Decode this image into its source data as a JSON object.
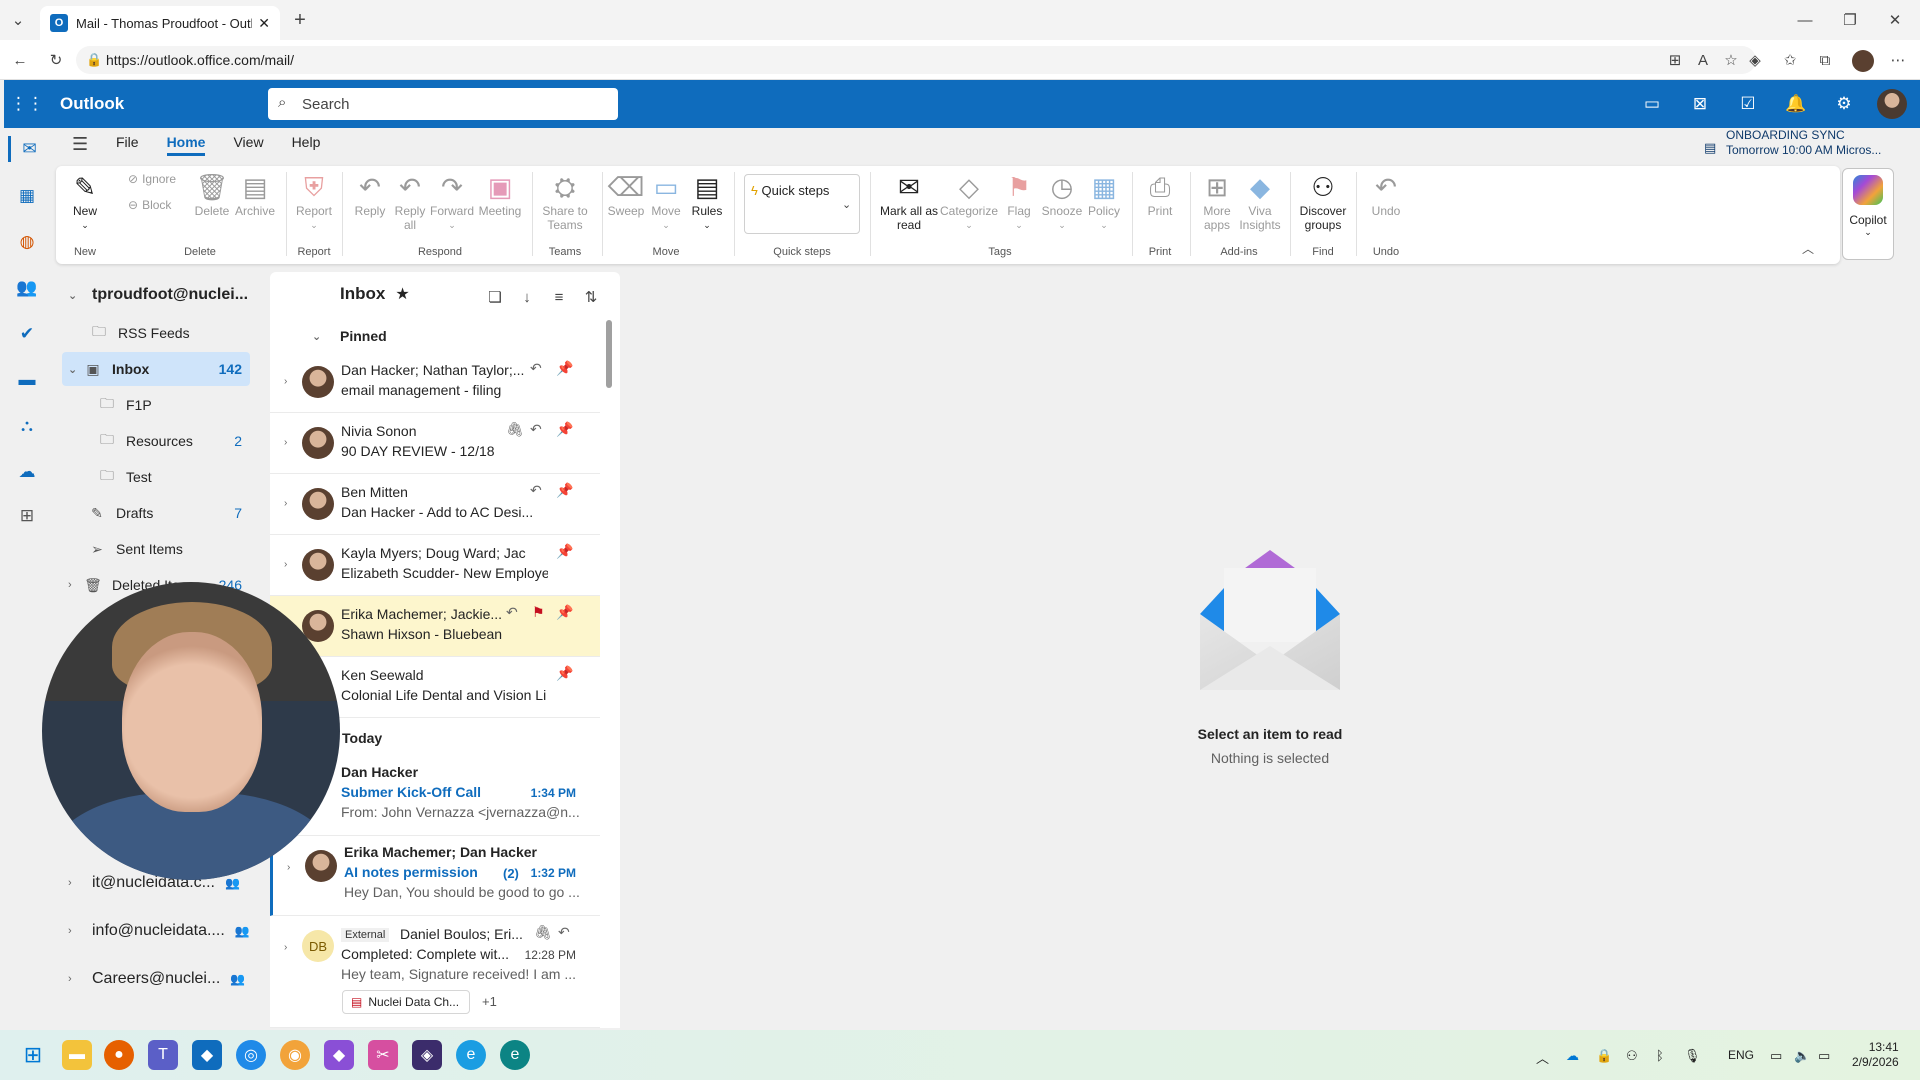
{
  "browser": {
    "tab_title": "Mail - Thomas Proudfoot - Outlook",
    "url": "https://outlook.office.com/mail/"
  },
  "app": {
    "name": "Outlook",
    "search_placeholder": "Search",
    "accent": "#0f6cbd"
  },
  "menu": [
    "File",
    "Home",
    "View",
    "Help"
  ],
  "onboarding": {
    "title": "ONBOARDING SYNC",
    "time": "Tomorrow 10:00 AM Micros..."
  },
  "ribbon": {
    "new": "New",
    "ignore": "Ignore",
    "block": "Block",
    "delete": "Delete",
    "archive": "Archive",
    "report": "Report",
    "reply": "Reply",
    "reply_all_1": "Reply",
    "reply_all_2": "all",
    "forward": "Forward",
    "meeting": "Meeting",
    "share_1": "Share to",
    "share_2": "Teams",
    "sweep": "Sweep",
    "move": "Move",
    "rules": "Rules",
    "quick_steps": "Quick steps",
    "mark_1": "Mark all as",
    "mark_2": "read",
    "categorize": "Categorize",
    "flag": "Flag",
    "snooze": "Snooze",
    "policy": "Policy",
    "print": "Print",
    "more_1": "More",
    "more_2": "apps",
    "viva_1": "Viva",
    "viva_2": "Insights",
    "discover_1": "Discover",
    "discover_2": "groups",
    "undo": "Undo",
    "copilot": "Copilot",
    "groups": {
      "new": "New",
      "delete": "Delete",
      "report": "Report",
      "respond": "Respond",
      "teams": "Teams",
      "move": "Move",
      "quick_steps": "Quick steps",
      "tags": "Tags",
      "print": "Print",
      "addins": "Add-ins",
      "find": "Find",
      "undo": "Undo"
    }
  },
  "folders": {
    "account": "tproudfoot@nuclei...",
    "items": [
      {
        "label": "RSS Feeds",
        "count": ""
      },
      {
        "label": "Inbox",
        "count": "142"
      },
      {
        "label": "F1P",
        "count": ""
      },
      {
        "label": "Resources",
        "count": "2"
      },
      {
        "label": "Test",
        "count": ""
      },
      {
        "label": "Drafts",
        "count": "7"
      },
      {
        "label": "Sent Items",
        "count": ""
      },
      {
        "label": "Deleted Items",
        "count": "246"
      }
    ],
    "shared": [
      "it@nucleidata.c...",
      "info@nucleidata....",
      "Careers@nuclei..."
    ]
  },
  "list": {
    "title": "Inbox",
    "pinned_label": "Pinned",
    "today_label": "Today",
    "pinned": [
      {
        "from": "Dan Hacker; Nathan Taylor;...",
        "subject": "email management - filing"
      },
      {
        "from": "Nivia Sonon",
        "subject": "90 DAY REVIEW - 12/18"
      },
      {
        "from": "Ben Mitten",
        "subject": "Dan Hacker - Add to AC Desi..."
      },
      {
        "from": "Kayla Myers; Doug Ward; Jacki...",
        "subject": "Elizabeth Scudder- New Employe"
      },
      {
        "from": "Erika Machemer; Jackie...",
        "subject": "Shawn Hixson - Bluebean"
      },
      {
        "from": "Ken Seewald",
        "subject": "Colonial Life Dental and Vision Li"
      }
    ],
    "today": [
      {
        "from": "Dan Hacker",
        "subject": "Submer Kick-Off Call",
        "time": "1:34 PM",
        "preview": "From: John Vernazza <jvernazza@n..."
      },
      {
        "from": "Erika Machemer; Dan Hacker",
        "subject": "AI notes permission",
        "count": "(2)",
        "time": "1:32 PM",
        "preview": "Hey Dan, You should be good to go ..."
      },
      {
        "badge": "External",
        "from": "Daniel Boulos; Eri...",
        "subject": "Completed: Complete wit...",
        "time": "12:28 PM",
        "preview": "Hey team, Signature received! I am ...",
        "attachment": "Nuclei Data Ch...",
        "more": "+1",
        "initials": "DB"
      }
    ]
  },
  "reading": {
    "title": "Select an item to read",
    "subtitle": "Nothing is selected"
  },
  "taskbar": {
    "lang": "ENG",
    "time": "13:41",
    "date": "2/9/2026"
  }
}
